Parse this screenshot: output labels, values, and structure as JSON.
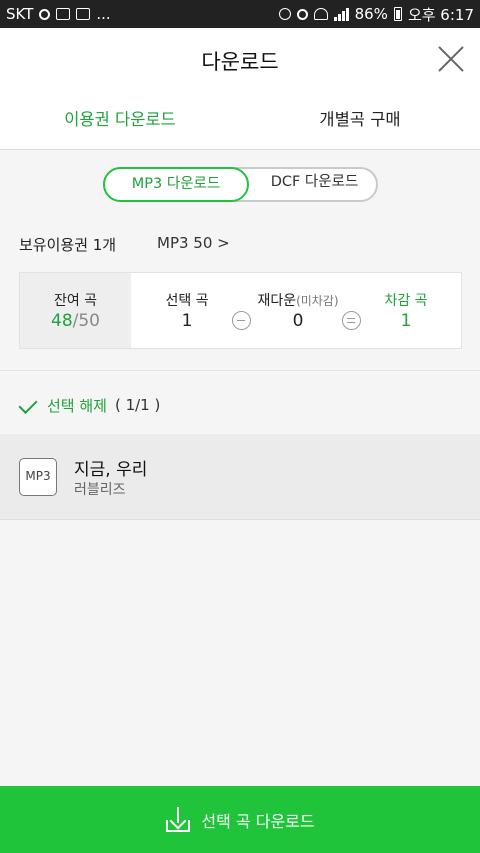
{
  "status_bar": {
    "carrier": "SKT",
    "more": "...",
    "battery": "86%",
    "time": "오후 6:17"
  },
  "header": {
    "title": "다운로드",
    "close_icon": "close-icon"
  },
  "tabs": [
    {
      "label": "이용권 다운로드",
      "active": true
    },
    {
      "label": "개별곡 구매",
      "active": false
    }
  ],
  "format_toggle": {
    "options": [
      "MP3 다운로드",
      "DCF 다운로드"
    ],
    "selected": "MP3 다운로드"
  },
  "owned_pass": {
    "label": "보유이용권 1개",
    "pass_name": "MP3 50 >"
  },
  "counter": {
    "remaining_label": "잔여 곡",
    "remaining_value": "48",
    "remaining_total": "/50",
    "selected_label": "선택 곡",
    "selected_value": "1",
    "redownload_label": "재다운",
    "redownload_note": "(미차감)",
    "redownload_value": "0",
    "deducted_label": "차감 곡",
    "deducted_value": "1"
  },
  "deselect": {
    "label": "선택 해제",
    "count": "( 1/1 )"
  },
  "songs": [
    {
      "badge": "MP3",
      "title": "지금, 우리",
      "artist": "러블리즈"
    }
  ],
  "bottom_button": {
    "label": "선택 곡 다운로드"
  },
  "colors": {
    "accent": "#1fa33a",
    "button": "#1fc43a"
  }
}
